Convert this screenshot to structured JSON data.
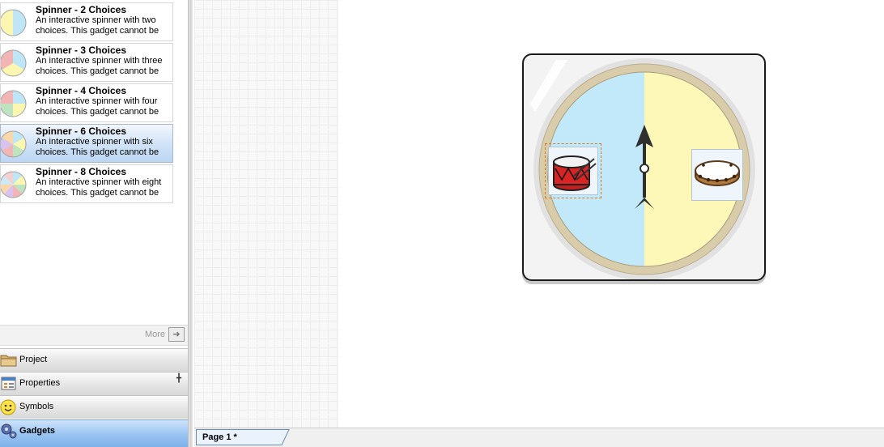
{
  "gadgets": {
    "items": [
      {
        "title": "Spinner - 2 Choices",
        "desc": "An interactive spinner with two choices. This gadget cannot be",
        "slices": [
          "#bfe6f7",
          "#fbf6b0"
        ]
      },
      {
        "title": "Spinner - 3 Choices",
        "desc": "An interactive spinner with three choices. This gadget cannot be",
        "slices": [
          "#bfe6f7",
          "#fbf6b0",
          "#f2b5b5"
        ]
      },
      {
        "title": "Spinner - 4 Choices",
        "desc": "An interactive spinner with four choices.  This gadget cannot be",
        "slices": [
          "#bfe6f7",
          "#fbf6b0",
          "#bfe3bf",
          "#f2b5b5"
        ]
      },
      {
        "title": "Spinner - 6 Choices",
        "desc": "An interactive spinner with six choices. This gadget cannot be",
        "slices": [
          "#bfe6f7",
          "#fbf6b0",
          "#bfe3bf",
          "#f2b5b5",
          "#d8c3ee",
          "#fbd6a8"
        ],
        "selected": true
      },
      {
        "title": "Spinner - 8 Choices",
        "desc": "An interactive spinner with eight choices. This gadget cannot be",
        "slices": [
          "#bfe6f7",
          "#fbf6b0",
          "#bfe3bf",
          "#f2b5b5",
          "#d8c3ee",
          "#fbd6a8",
          "#cde9f4",
          "#f5d0d0"
        ]
      }
    ],
    "more_label": "More",
    "more_icon": "arrow-right-icon"
  },
  "nav": {
    "project": {
      "label": "Project",
      "icon": "folder-icon"
    },
    "properties": {
      "label": "Properties",
      "icon": "properties-icon"
    },
    "symbols": {
      "label": "Symbols",
      "icon": "smiley-icon"
    },
    "gadgets": {
      "label": "Gadgets",
      "icon": "gears-icon"
    }
  },
  "canvas": {
    "spinner": {
      "colors": {
        "left": "#c2e9fa",
        "right": "#fdf8b8",
        "rim": "#d8ccaa"
      },
      "choices": [
        {
          "icon": "drum-icon"
        },
        {
          "icon": "tambourine-icon"
        }
      ]
    }
  },
  "tabs": {
    "page1": "Page 1 *"
  }
}
